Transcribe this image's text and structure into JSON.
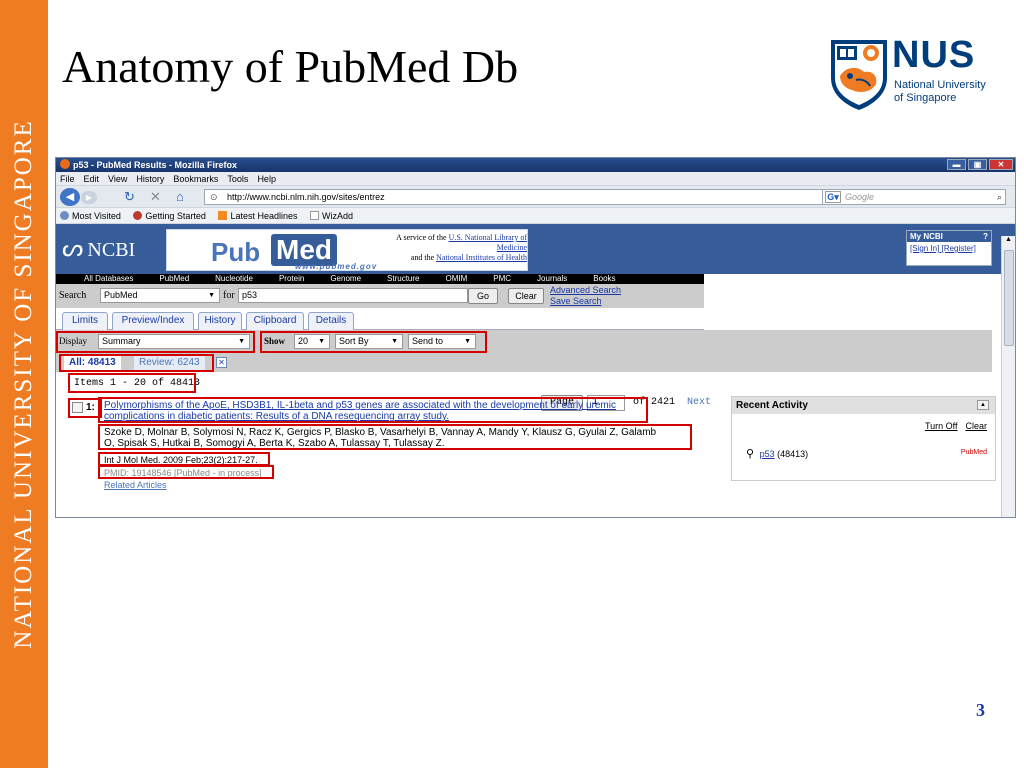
{
  "slide": {
    "band_text": "NATIONAL UNIVERSITY OF SINGAPORE",
    "title": "Anatomy of PubMed Db",
    "logo": {
      "name": "NUS",
      "line1": "National University",
      "line2": "of Singapore"
    },
    "page_number": "3"
  },
  "browser": {
    "window_title": "p53 - PubMed Results - Mozilla Firefox",
    "menu": [
      "File",
      "Edit",
      "View",
      "History",
      "Bookmarks",
      "Tools",
      "Help"
    ],
    "url": "http://www.ncbi.nlm.nih.gov/sites/entrez",
    "search_engine_placeholder": "Google",
    "bookmarks": [
      "Most Visited",
      "Getting Started",
      "Latest Headlines",
      "WizAdd"
    ]
  },
  "ncbi": {
    "logo": "NCBI",
    "pubmed_pub": "Pub",
    "pubmed_med": "Med",
    "pubmed_url": "www.pubmed.gov",
    "service_line1": "A service of the",
    "service_link1": "U.S. National Library of Medicine",
    "service_line2": "and the",
    "service_link2": "National Institutes of Health",
    "myncbi_title": "My NCBI",
    "myncbi_help": "?",
    "myncbi_signin": "[Sign In]",
    "myncbi_register": "[Register]",
    "db_tabs": [
      "All Databases",
      "PubMed",
      "Nucleotide",
      "Protein",
      "Genome",
      "Structure",
      "OMIM",
      "PMC",
      "Journals",
      "Books"
    ]
  },
  "search": {
    "label": "Search",
    "db_value": "PubMed",
    "for_label": "for",
    "query": "p53",
    "go": "Go",
    "clear": "Clear",
    "advanced": "Advanced Search",
    "save": "Save Search"
  },
  "tabs": [
    "Limits",
    "Preview/Index",
    "History",
    "Clipboard",
    "Details"
  ],
  "display": {
    "display_label": "Display",
    "display_value": "Summary",
    "show_label": "Show",
    "show_value": "20",
    "sortby": "Sort By",
    "sendto": "Send to"
  },
  "filters": {
    "all": "All: 48413",
    "review": "Review: 6243"
  },
  "items": {
    "range": "Items 1 - 20 of 48413",
    "page_label": "Page",
    "page_value": "1",
    "of_pages": "of 2421",
    "next": "Next"
  },
  "result": {
    "number": "1:",
    "title_line1": "Polymorphisms of the ApoE, HSD3B1, IL-1beta and p53 genes are associated with the development of early uremic",
    "title_line2": "complications in diabetic patients: Results of a DNA resequencing array study.",
    "authors_line1": "Szoke D, Molnar B, Solymosi N, Racz K, Gergics P, Blasko B, Vasarhelyi B, Vannay A, Mandy Y, Klausz G, Gyulai Z, Galamb",
    "authors_line2": "O, Spisak S, Hutkai B, Somogyi A, Berta K, Szabo A, Tulassay T, Tulassay Z.",
    "journal": "Int J Mol Med. 2009 Feb;23(2):217-27.",
    "pmid": "PMID: 19148546 [PubMed - in process]",
    "related": "Related Articles"
  },
  "recent": {
    "title": "Recent Activity",
    "turn_off": "Turn Off",
    "clear": "Clear",
    "item_link": "p53",
    "item_count": "(48413)",
    "item_db": "PubMed"
  },
  "colors": {
    "band": "#ef7c22",
    "ncbi_blue": "#365d99",
    "highlight": "#d40000",
    "nus_blue": "#003d7c"
  }
}
